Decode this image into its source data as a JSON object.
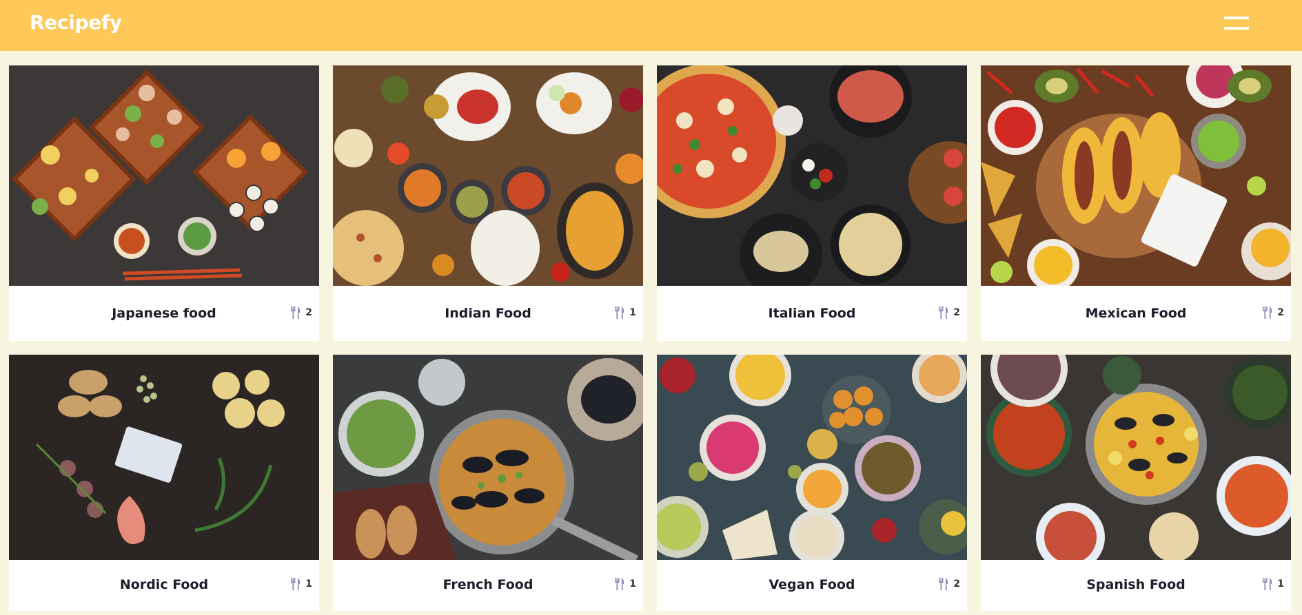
{
  "app": {
    "title": "Recipefy"
  },
  "header": {
    "menu_icon": "hamburger-menu-icon"
  },
  "colors": {
    "header": "#ffc95a",
    "background": "#f7f4df",
    "card": "#ffffff",
    "icon": "#8d90b8"
  },
  "categories": [
    {
      "name": "Japanese food",
      "count": "2",
      "icon": "utensils-icon"
    },
    {
      "name": "Indian Food",
      "count": "1",
      "icon": "utensils-icon"
    },
    {
      "name": "Italian Food",
      "count": "2",
      "icon": "utensils-icon"
    },
    {
      "name": "Mexican Food",
      "count": "2",
      "icon": "utensils-icon"
    },
    {
      "name": "Nordic Food",
      "count": "1",
      "icon": "utensils-icon"
    },
    {
      "name": "French Food",
      "count": "1",
      "icon": "utensils-icon"
    },
    {
      "name": "Vegan Food",
      "count": "2",
      "icon": "utensils-icon"
    },
    {
      "name": "Spanish Food",
      "count": "1",
      "icon": "utensils-icon"
    }
  ]
}
